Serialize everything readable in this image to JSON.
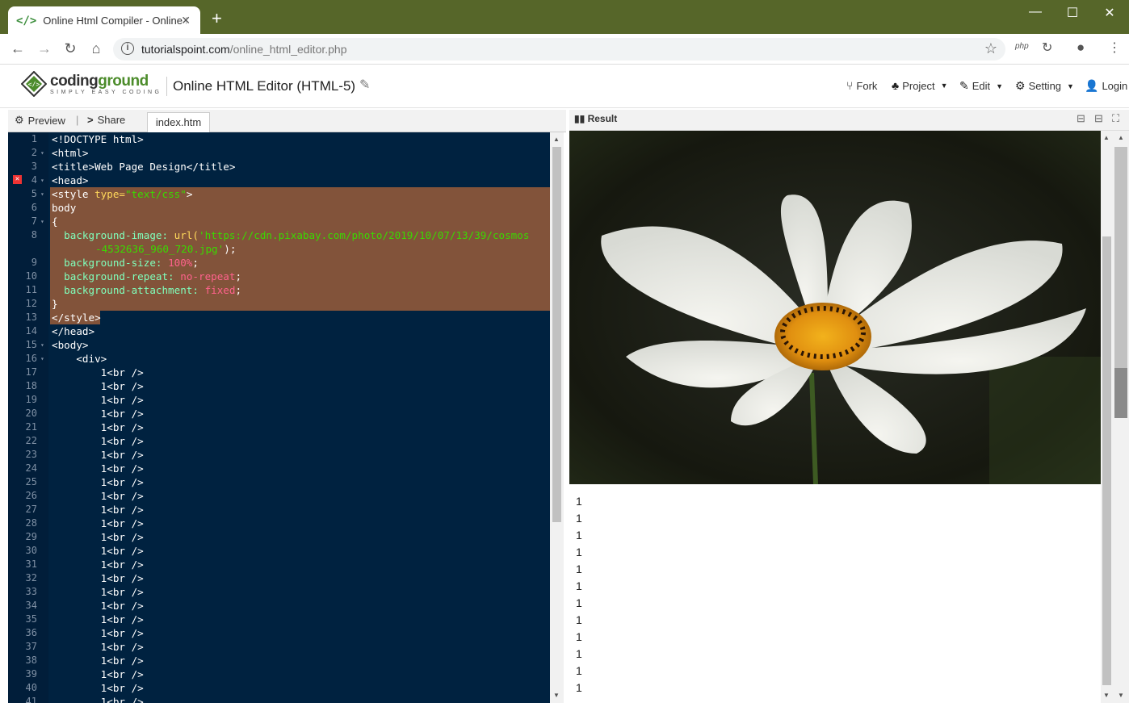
{
  "browser": {
    "tab_title": "Online Html Compiler - Online H",
    "tab_favicon": "</>",
    "url_host": "tutorialspoint.com",
    "url_path": "/online_html_editor.php"
  },
  "app": {
    "logo_text_a": "coding",
    "logo_text_b": "ground",
    "logo_sub": "SIMPLY EASY CODING",
    "title": "Online HTML Editor (HTML-5)",
    "menu": {
      "fork": "Fork",
      "project": "Project",
      "edit": "Edit",
      "setting": "Setting",
      "login": "Login"
    }
  },
  "editor_tabs": {
    "preview": "Preview",
    "share": "Share",
    "file": "index.htm"
  },
  "result": {
    "label": "Result",
    "output_lines": [
      "1",
      "1",
      "1",
      "1",
      "1",
      "1",
      "1",
      "1",
      "1",
      "1",
      "1",
      "1"
    ]
  },
  "code": {
    "line1": "<!DOCTYPE html>",
    "line2": "<html>",
    "line3_a": "<title>",
    "line3_b": "Web Page Design",
    "line3_c": "</title>",
    "line4": "<head>",
    "line5_a": "<style ",
    "line5_b": "type=",
    "line5_c": "\"text/css\"",
    "line5_d": ">",
    "line6": "body",
    "line7": "{",
    "line8_a": "  background-image: ",
    "line8_b": "url(",
    "line8_c": "'https://cdn.pixabay.com/photo/2019/10/07/13/39/cosmos",
    "line8_d": "-4532636_960_720.jpg'",
    "line8_e": ");",
    "line9_a": "  background-size: ",
    "line9_b": "100%",
    "line9_c": ";",
    "line10_a": "  background-repeat: ",
    "line10_b": "no-repeat",
    "line10_c": ";",
    "line11_a": "  background-attachment: ",
    "line11_b": "fixed",
    "line11_c": ";",
    "line12": "}",
    "line13": "</style>",
    "line14": "</head>",
    "line15": "<body>",
    "line16": "    <div>",
    "br_line": "        1<br />"
  }
}
